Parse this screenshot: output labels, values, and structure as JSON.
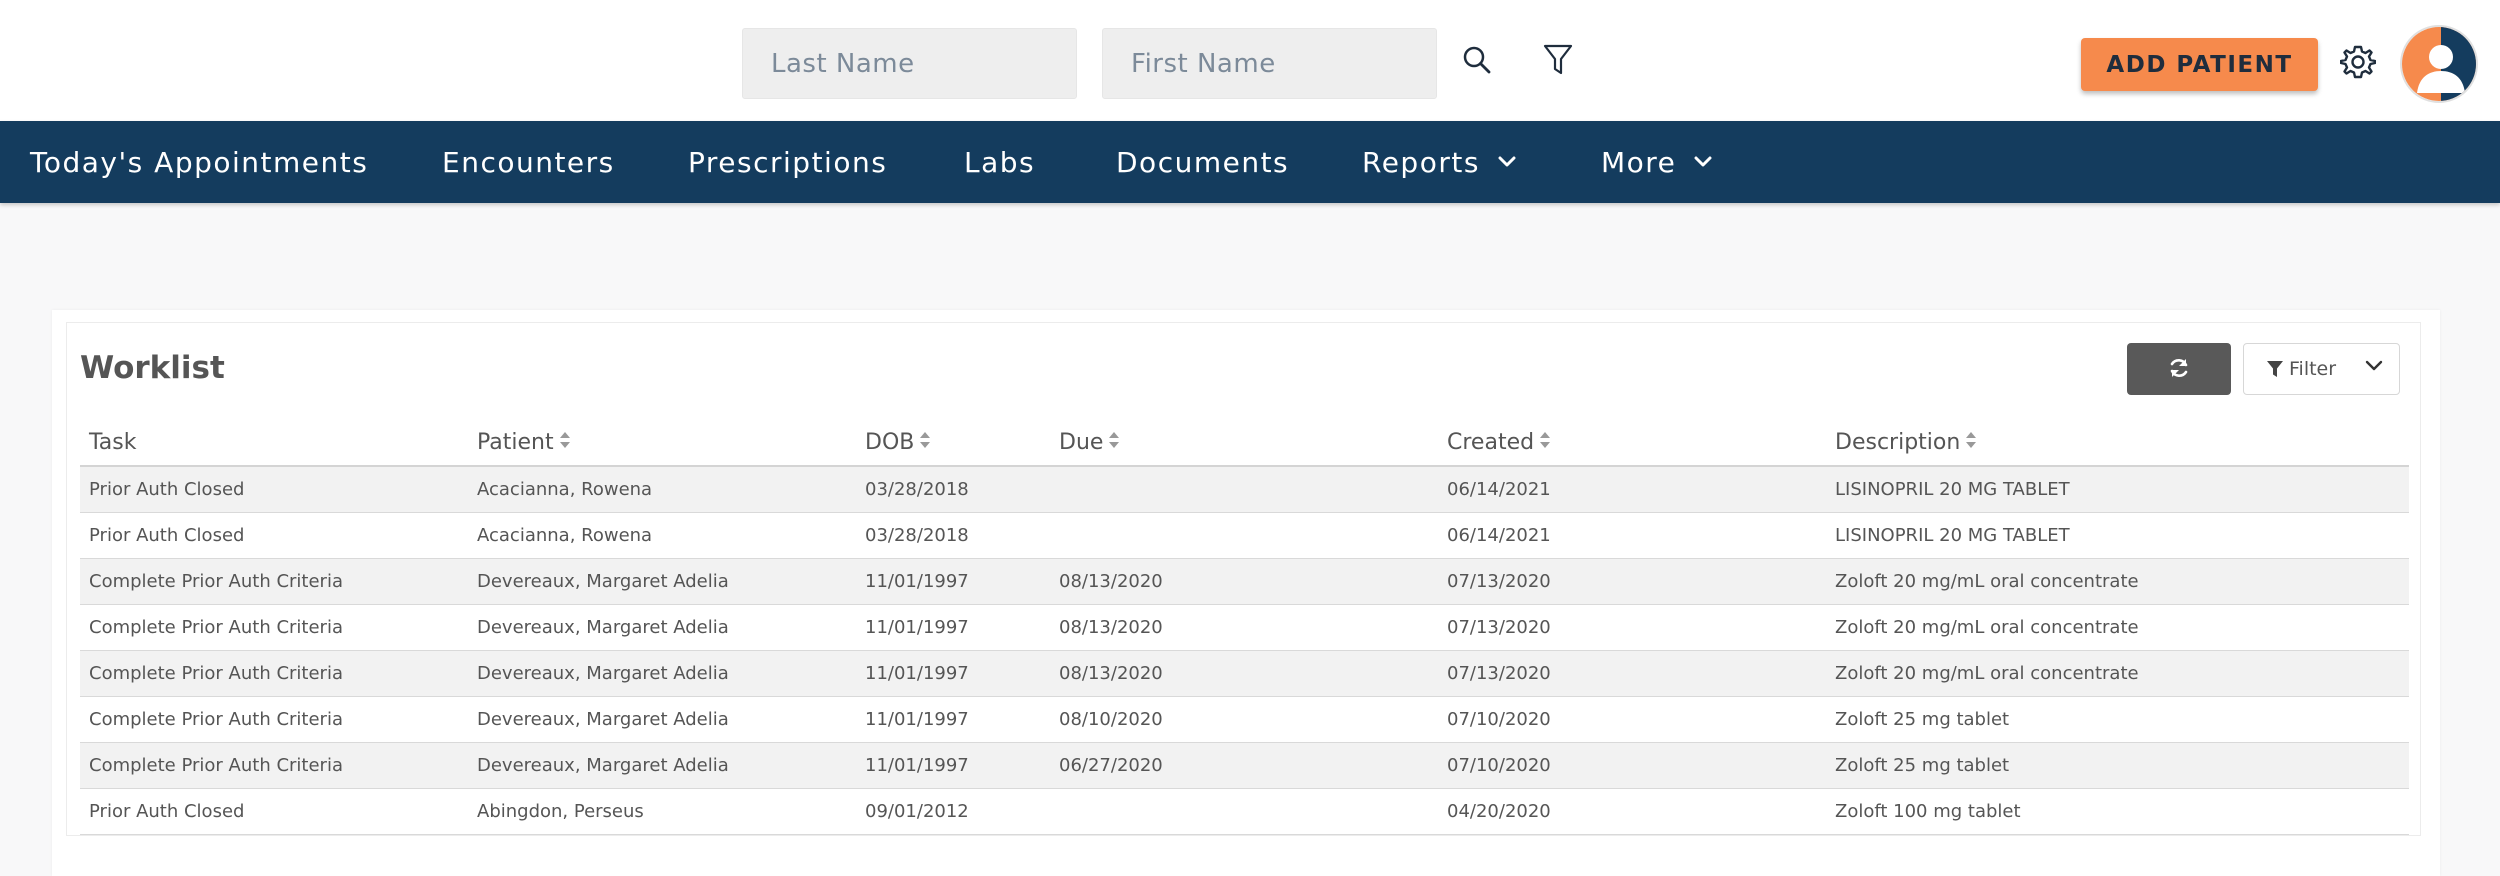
{
  "header": {
    "last_name_placeholder": "Last Name",
    "first_name_placeholder": "First Name",
    "search_icon": "search-icon",
    "filter_icon": "filter-icon",
    "add_patient_label": "ADD PATIENT",
    "settings_icon": "gear-icon",
    "avatar_icon": "user-avatar-icon",
    "accent_color": "#f68a4c"
  },
  "nav": {
    "background_color": "#143c5e",
    "items": [
      {
        "label": "Today's Appointments",
        "has_dropdown": false
      },
      {
        "label": "Encounters",
        "has_dropdown": false
      },
      {
        "label": "Prescriptions",
        "has_dropdown": false
      },
      {
        "label": "Labs",
        "has_dropdown": false
      },
      {
        "label": "Documents",
        "has_dropdown": false
      },
      {
        "label": "Reports",
        "has_dropdown": true
      },
      {
        "label": "More",
        "has_dropdown": true
      }
    ]
  },
  "worklist": {
    "title": "Worklist",
    "refresh_icon": "refresh-icon",
    "filter_label": "Filter",
    "columns": [
      {
        "label": "Task",
        "sortable": false
      },
      {
        "label": "Patient",
        "sortable": true
      },
      {
        "label": "DOB",
        "sortable": true
      },
      {
        "label": "Due",
        "sortable": true
      },
      {
        "label": "Created",
        "sortable": true
      },
      {
        "label": "Description",
        "sortable": true
      }
    ],
    "rows": [
      {
        "task": "Prior Auth Closed",
        "patient": "Acacianna, Rowena",
        "dob": "03/28/2018",
        "due": "",
        "created": "06/14/2021",
        "description": "LISINOPRIL 20 MG TABLET"
      },
      {
        "task": "Prior Auth Closed",
        "patient": "Acacianna, Rowena",
        "dob": "03/28/2018",
        "due": "",
        "created": "06/14/2021",
        "description": "LISINOPRIL 20 MG TABLET"
      },
      {
        "task": "Complete Prior Auth Criteria",
        "patient": "Devereaux, Margaret Adelia",
        "dob": "11/01/1997",
        "due": "08/13/2020",
        "created": "07/13/2020",
        "description": "Zoloft 20 mg/mL oral concentrate"
      },
      {
        "task": "Complete Prior Auth Criteria",
        "patient": "Devereaux, Margaret Adelia",
        "dob": "11/01/1997",
        "due": "08/13/2020",
        "created": "07/13/2020",
        "description": "Zoloft 20 mg/mL oral concentrate"
      },
      {
        "task": "Complete Prior Auth Criteria",
        "patient": "Devereaux, Margaret Adelia",
        "dob": "11/01/1997",
        "due": "08/13/2020",
        "created": "07/13/2020",
        "description": "Zoloft 20 mg/mL oral concentrate"
      },
      {
        "task": "Complete Prior Auth Criteria",
        "patient": "Devereaux, Margaret Adelia",
        "dob": "11/01/1997",
        "due": "08/10/2020",
        "created": "07/10/2020",
        "description": "Zoloft 25 mg tablet"
      },
      {
        "task": "Complete Prior Auth Criteria",
        "patient": "Devereaux, Margaret Adelia",
        "dob": "11/01/1997",
        "due": "06/27/2020",
        "created": "07/10/2020",
        "description": "Zoloft 25 mg tablet"
      },
      {
        "task": "Prior Auth Closed",
        "patient": "Abingdon, Perseus",
        "dob": "09/01/2012",
        "due": "",
        "created": "04/20/2020",
        "description": "Zoloft 100 mg tablet"
      }
    ]
  }
}
